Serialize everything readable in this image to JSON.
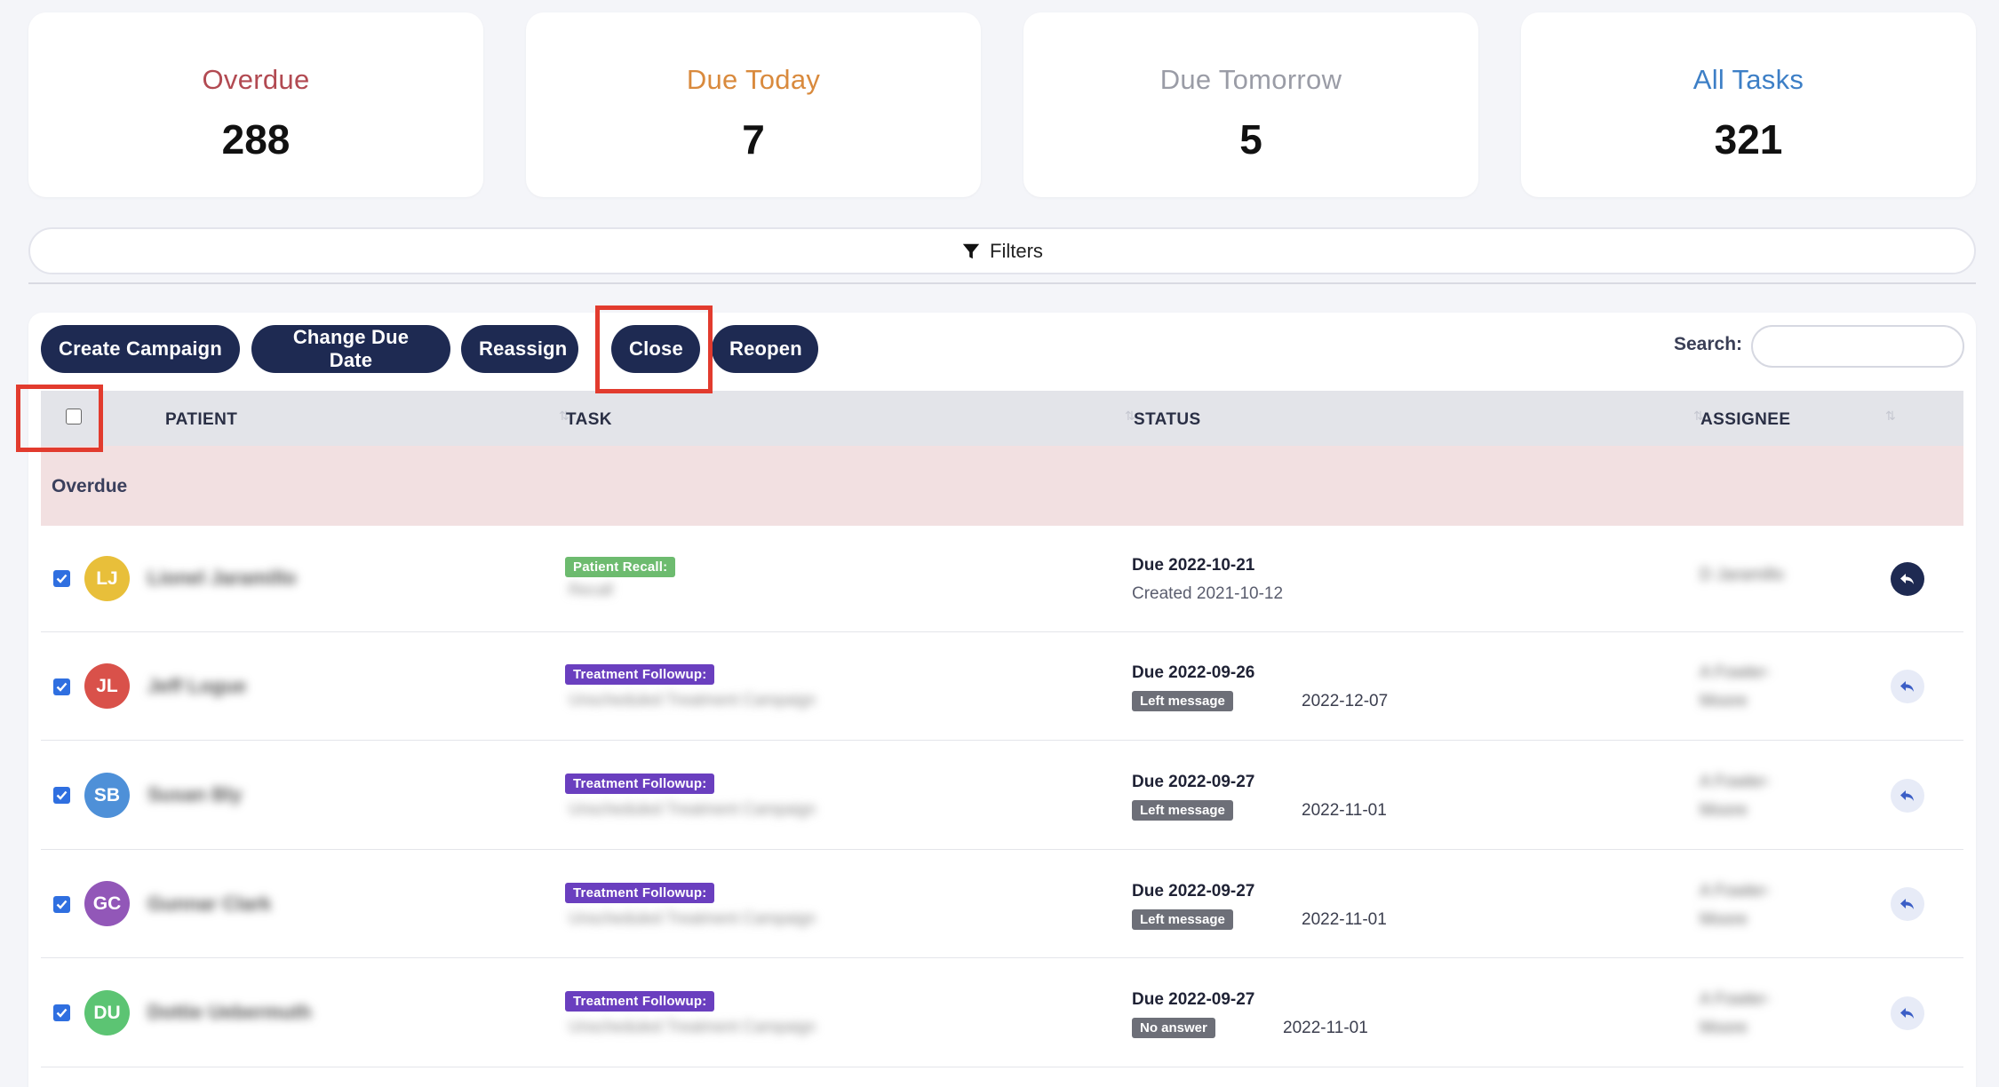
{
  "stats": [
    {
      "label": "Overdue",
      "value": "288",
      "color": "#b24a52"
    },
    {
      "label": "Due Today",
      "value": "7",
      "color": "#d98a3d"
    },
    {
      "label": "Due Tomorrow",
      "value": "5",
      "color": "#9a9ca6"
    },
    {
      "label": "All Tasks",
      "value": "321",
      "color": "#3d7fc6"
    }
  ],
  "filters": {
    "label": "Filters",
    "icon": "funnel-icon"
  },
  "toolbar": {
    "create_campaign": "Create Campaign",
    "change_due_date": "Change Due Date",
    "reassign": "Reassign",
    "close": "Close",
    "reopen": "Reopen",
    "search_label": "Search:",
    "search_value": ""
  },
  "table": {
    "headers": {
      "patient": "PATIENT",
      "task": "TASK",
      "status": "STATUS",
      "assignee": "ASSIGNEE"
    },
    "group_label": "Overdue",
    "rows": [
      {
        "initials": "LJ",
        "avatar_color": "#e8bf3a",
        "patient": "Lionel Jaramillo",
        "task_tag": "Patient Recall:",
        "task_tag_color": "#6dbb6f",
        "task_detail": "Recall",
        "due": "Due 2022-10-21",
        "created": "Created 2021-10-12",
        "status_tag": "",
        "status_date": "",
        "assignee": "D Jaramillo",
        "checked": true
      },
      {
        "initials": "JL",
        "avatar_color": "#d9514a",
        "patient": "Jeff Logue",
        "task_tag": "Treatment Followup:",
        "task_tag_color": "#6a3fbf",
        "task_detail": "Unscheduled Treatment Campaign",
        "due": "Due 2022-09-26",
        "created": "",
        "status_tag": "Left message",
        "status_date": "2022-12-07",
        "assignee": "A Fowler-Moore",
        "checked": true
      },
      {
        "initials": "SB",
        "avatar_color": "#4e90d8",
        "patient": "Susan Bly",
        "task_tag": "Treatment Followup:",
        "task_tag_color": "#6a3fbf",
        "task_detail": "Unscheduled Treatment Campaign",
        "due": "Due 2022-09-27",
        "created": "",
        "status_tag": "Left message",
        "status_date": "2022-11-01",
        "assignee": "A Fowler-Moore",
        "checked": true
      },
      {
        "initials": "GC",
        "avatar_color": "#9257b8",
        "patient": "Gunnar Clark",
        "task_tag": "Treatment Followup:",
        "task_tag_color": "#6a3fbf",
        "task_detail": "Unscheduled Treatment Campaign",
        "due": "Due 2022-09-27",
        "created": "",
        "status_tag": "Left message",
        "status_date": "2022-11-01",
        "assignee": "A Fowler-Moore",
        "checked": true
      },
      {
        "initials": "DU",
        "avatar_color": "#5cc473",
        "patient": "Dottie Uebermuth",
        "task_tag": "Treatment Followup:",
        "task_tag_color": "#6a3fbf",
        "task_detail": "Unscheduled Treatment Campaign",
        "due": "Due 2022-09-27",
        "created": "",
        "status_tag": "No answer",
        "status_date": "2022-11-01",
        "assignee": "A Fowler-Moore",
        "checked": true
      }
    ]
  }
}
